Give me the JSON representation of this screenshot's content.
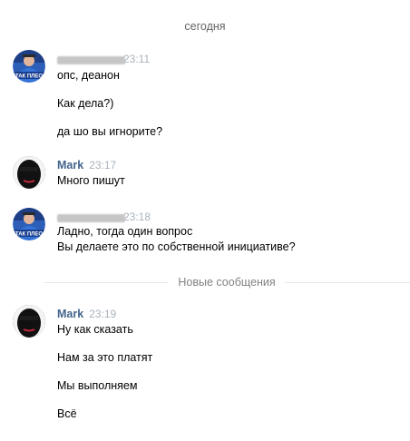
{
  "date_separator": "сегодня",
  "new_messages_separator": "Новые сообщения",
  "groups": [
    {
      "author": "",
      "time": "23:11",
      "avatar_caption": "ТАК ПЛЕО",
      "messages": [
        "опс, деанон",
        "Как дела?)",
        "да шо вы игнорите?"
      ]
    },
    {
      "author": "Mark",
      "time": "23:17",
      "messages": [
        "Много пишут"
      ]
    },
    {
      "author": "",
      "time": "23:18",
      "avatar_caption": "ТАК ПЛЕО",
      "messages": [
        "Ладно, тогда один вопрос",
        "Вы делаете это по собственной инициативе?"
      ]
    },
    {
      "author": "Mark",
      "time": "23:19",
      "messages": [
        "Ну как сказать",
        "Нам за это платят",
        "Мы выполняем",
        "Всё"
      ]
    }
  ],
  "colors": {
    "author": "#42648b",
    "time": "#a8b2bd",
    "separator_text": "#828282",
    "separator_line": "#e7e8ec"
  }
}
